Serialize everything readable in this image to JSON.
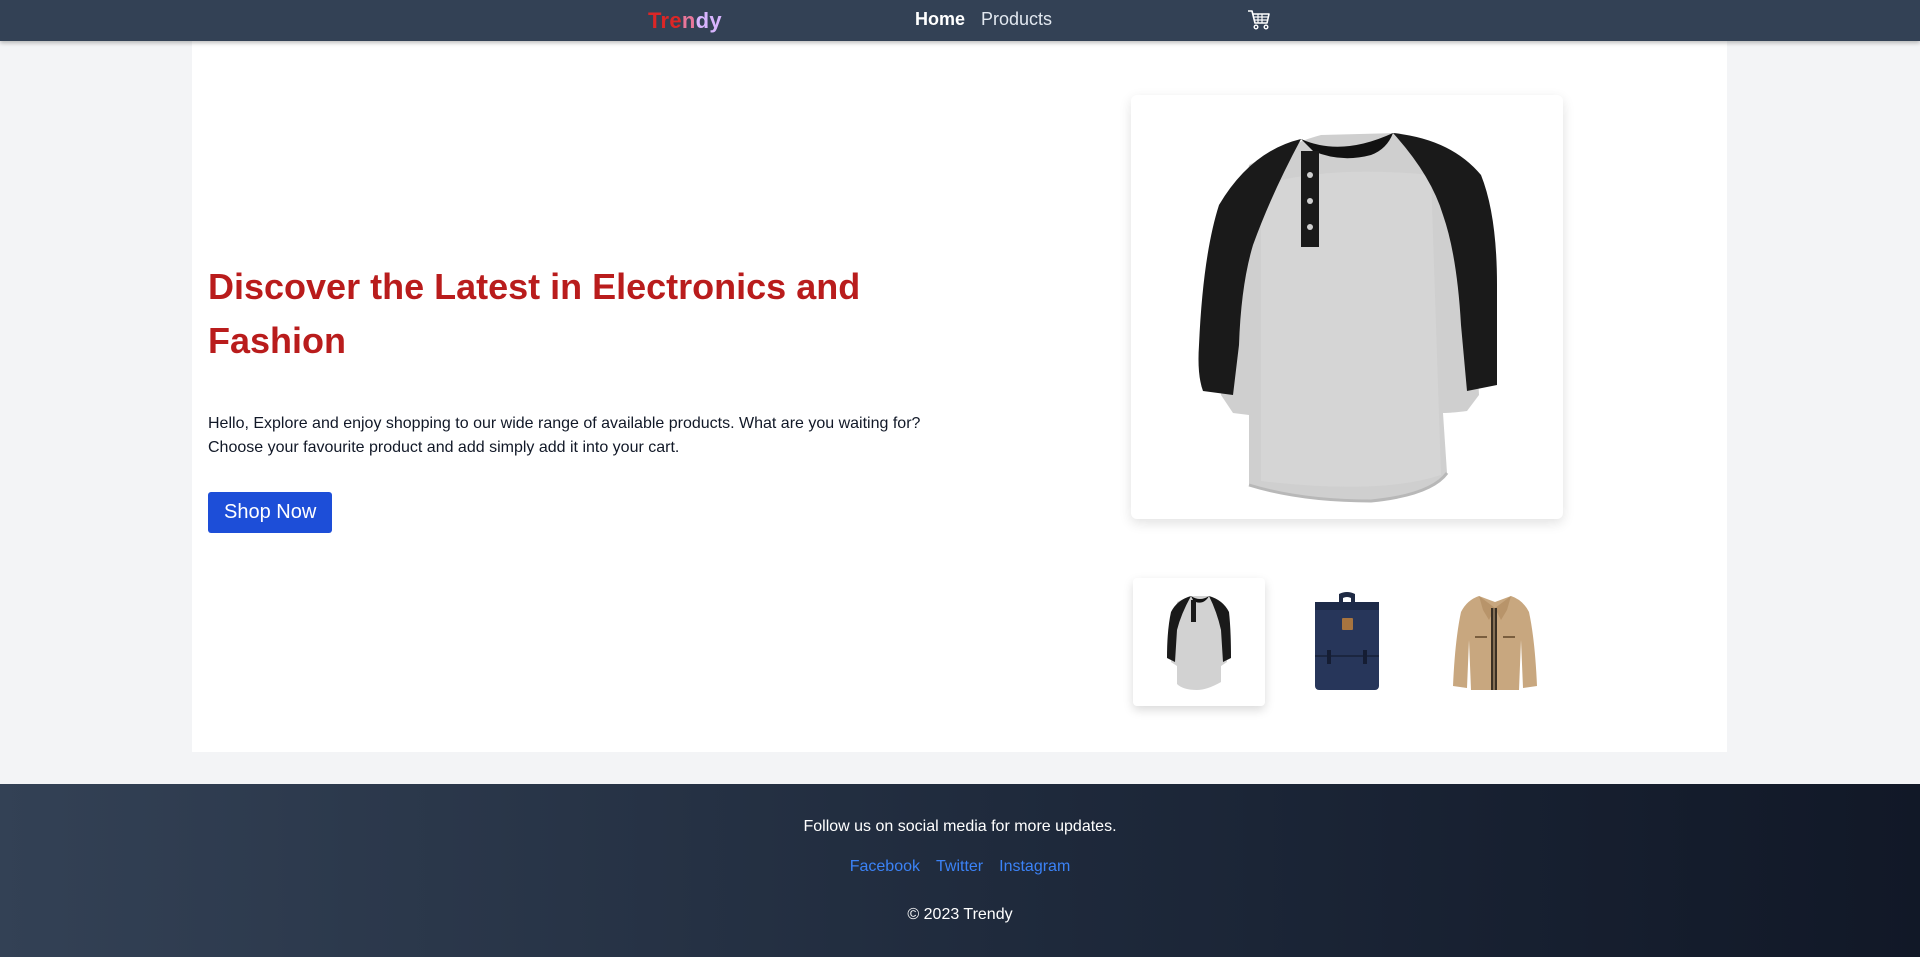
{
  "nav": {
    "brand": {
      "part1": "Tre",
      "part2": "n",
      "part3": "dy"
    },
    "links": [
      {
        "label": "Home",
        "active": true
      },
      {
        "label": "Products",
        "active": false
      }
    ],
    "cart_icon": "cart-icon"
  },
  "hero": {
    "title": "Discover the Latest in Electronics and Fashion",
    "description": "Hello, Explore and enjoy shopping to our wide range of available products. What are you waiting for? Choose your favourite product and add simply add it into your cart.",
    "cta_label": "Shop Now",
    "main_image": "raglan-henley-shirt",
    "thumbnails": [
      {
        "image": "raglan-henley-shirt",
        "selected": true
      },
      {
        "image": "navy-backpack",
        "selected": false
      },
      {
        "image": "khaki-jacket",
        "selected": false
      }
    ]
  },
  "footer": {
    "tagline": "Follow us on social media for more updates.",
    "links": [
      "Facebook",
      "Twitter",
      "Instagram"
    ],
    "copyright": "© 2023 Trendy"
  },
  "colors": {
    "nav_bg": "#334155",
    "title_red": "#b91c1c",
    "button_blue": "#1d4ed8",
    "link_blue": "#3b82f6"
  }
}
